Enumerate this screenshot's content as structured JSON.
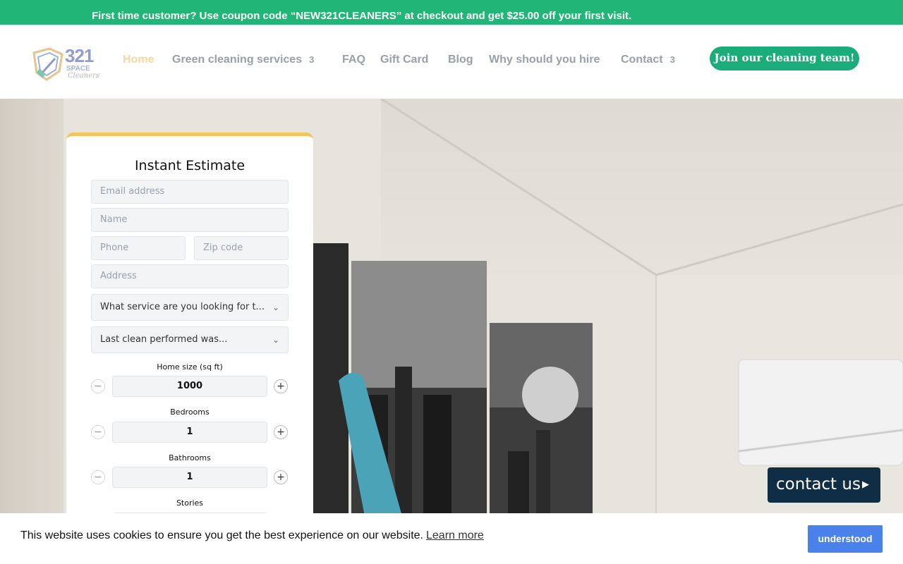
{
  "promo": {
    "text": "First time customer? Use coupon code “NEW321CLEANERS” at checkout and get $25.00 off your first visit."
  },
  "logo": {
    "number": "321",
    "line1": "SPACE",
    "line2": "Cleaners"
  },
  "nav": {
    "items": [
      {
        "label": "Home",
        "active": true
      },
      {
        "label": "Green cleaning services",
        "has_submenu": true
      },
      {
        "label": "FAQ"
      },
      {
        "label": "Gift Card"
      },
      {
        "label": "Blog"
      },
      {
        "label": "Why should you hire"
      },
      {
        "label": "Contact",
        "has_submenu": true
      }
    ],
    "submenu_glyph": "3"
  },
  "join_button": "Join our cleaning team!",
  "form": {
    "title": "Instant Estimate",
    "email_placeholder": "Email address",
    "name_placeholder": "Name",
    "phone_placeholder": "Phone",
    "zip_placeholder": "Zip code",
    "address_placeholder": "Address",
    "service_select": "What service are you looking for t...",
    "last_clean_select": "Last clean performed was...",
    "steppers": [
      {
        "label": "Home size (sq ft)",
        "value": "1000"
      },
      {
        "label": "Bedrooms",
        "value": "1"
      },
      {
        "label": "Bathrooms",
        "value": "1"
      },
      {
        "label": "Stories",
        "value": ""
      }
    ],
    "minus_glyph": "−",
    "plus_glyph": "+"
  },
  "contact_button": "contact us",
  "cookie": {
    "message": "This website uses cookies to ensure you get the best experience on our website.",
    "learn_more": "Learn more",
    "accept": "understood"
  },
  "colors": {
    "promo_bar": "#21b678",
    "join_button": "#1aad7a",
    "nav_active": "#f5d7a4",
    "form_accent": "#f2c45a",
    "contact_button": "#0f2d45",
    "cookie_button": "#4a82ec"
  }
}
